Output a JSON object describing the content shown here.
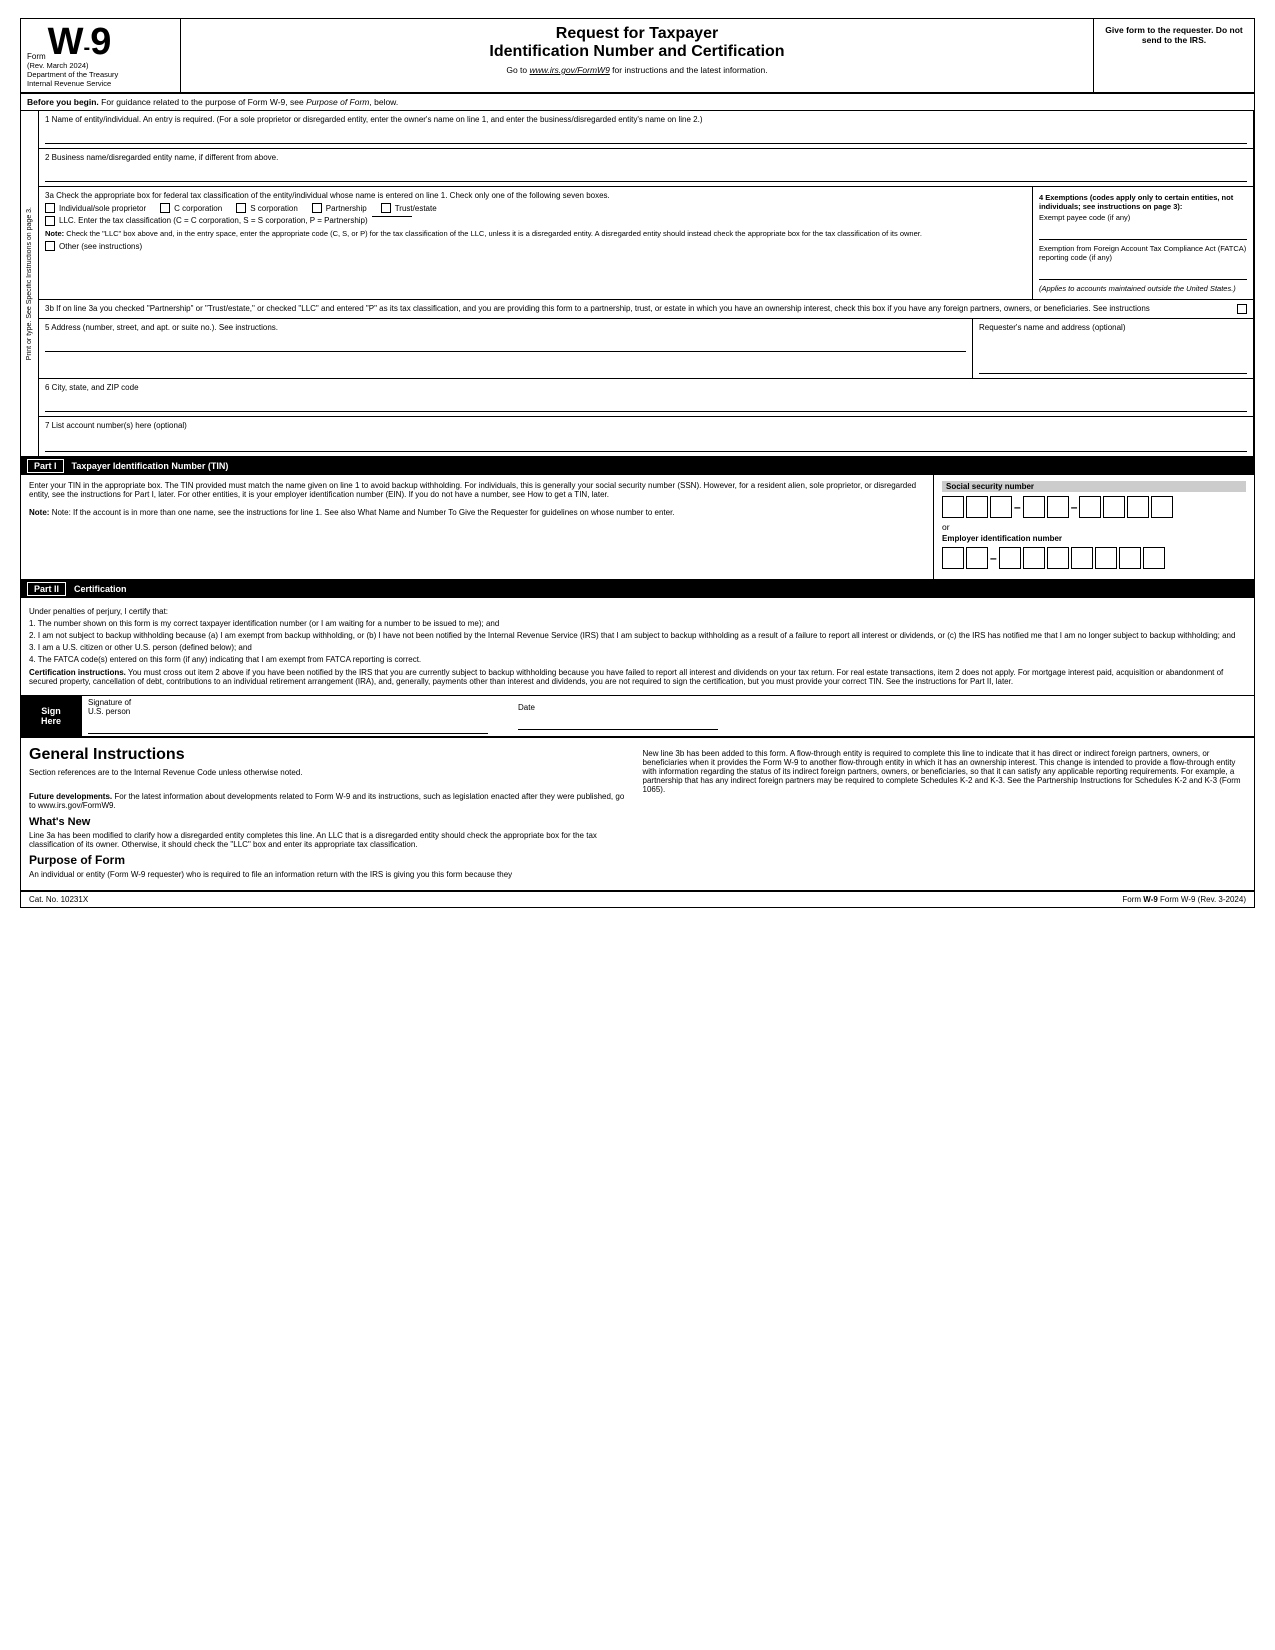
{
  "header": {
    "form_label": "Form",
    "form_number": "W-9",
    "rev_date": "(Rev. March 2024)",
    "dept": "Department of the Treasury",
    "irs": "Internal Revenue Service",
    "title1": "Request for Taxpayer",
    "title2": "Identification Number and Certification",
    "instructions_link": "Go to www.irs.gov/FormW9 for instructions and the latest information.",
    "give_form": "Give form to the requester. Do not send to the IRS."
  },
  "begin_bar": {
    "text": "Before you begin. For guidance related to the purpose of Form W-9, see Purpose of Form, below."
  },
  "fields": {
    "field1_label": "1  Name of entity/individual. An entry is required. (For a sole proprietor or disregarded entity, enter the owner's name on line 1, and enter the business/disregarded entity's name on line 2.)",
    "field2_label": "2  Business name/disregarded entity name, if different from above.",
    "field3a_label": "3a Check the appropriate box for federal tax classification of the entity/individual whose name is entered on line 1. Check only one of the following seven boxes.",
    "checkbox1": "Individual/sole proprietor",
    "checkbox2": "C corporation",
    "checkbox3": "S corporation",
    "checkbox4": "Partnership",
    "checkbox5": "Trust/estate",
    "llc_label": "LLC. Enter the tax classification (C = C corporation, S = S corporation, P = Partnership)",
    "note_label": "Note:",
    "note_text": "Check the \"LLC\" box above and, in the entry space, enter the appropriate code (C, S, or P) for the tax classification of the LLC, unless it is a disregarded entity. A disregarded entity should instead check the appropriate box for the tax classification of its owner.",
    "other_label": "Other (see instructions)",
    "field4_label": "4 Exemptions (codes apply only to certain entities, not individuals; see instructions on page 3):",
    "exempt_payee": "Exempt payee code (if any)",
    "fatca_label": "Exemption from Foreign Account Tax Compliance Act (FATCA) reporting code (if any)",
    "applies_label": "(Applies to accounts maintained outside the United States.)",
    "field3b_text": "3b If on line 3a you checked \"Partnership\" or \"Trust/estate,\" or checked \"LLC\" and entered \"P\" as its tax classification, and you are providing this form to a partnership, trust, or estate in which you have an ownership interest, check this box if you have any foreign partners, owners, or beneficiaries. See instructions",
    "field5_label": "5  Address (number, street, and apt. or suite no.). See instructions.",
    "requester_label": "Requester's name and address (optional)",
    "field6_label": "6  City, state, and ZIP code",
    "field7_label": "7  List account number(s) here (optional)"
  },
  "part1": {
    "label": "Part I",
    "title": "Taxpayer Identification Number (TIN)",
    "instructions": "Enter your TIN in the appropriate box. The TIN provided must match the name given on line 1 to avoid backup withholding. For individuals, this is generally your social security number (SSN). However, for a resident alien, sole proprietor, or disregarded entity, see the instructions for Part I, later. For other entities, it is your employer identification number (EIN). If you do not have a number, see How to get a TIN, later.",
    "note": "Note: If the account is in more than one name, see the instructions for line 1. See also What Name and Number To Give the Requester for guidelines on whose number to enter.",
    "ssn_label": "Social security number",
    "or_label": "or",
    "ein_label": "Employer identification number"
  },
  "part2": {
    "label": "Part II",
    "title": "Certification",
    "intro": "Under penalties of perjury, I certify that:",
    "item1": "1. The number shown on this form is my correct taxpayer identification number (or I am waiting for a number to be issued to me); and",
    "item2": "2. I am not subject to backup withholding because (a) I am exempt from backup withholding, or (b) I have not been notified by the Internal Revenue Service (IRS) that I am subject to backup withholding as a result of a failure to report all interest or dividends, or (c) the IRS has notified me that I am no longer subject to backup withholding; and",
    "item3": "3. I am a U.S. citizen or other U.S. person (defined below); and",
    "item4": "4. The FATCA code(s) entered on this form (if any) indicating that I am exempt from FATCA reporting is correct.",
    "cert_instructions_label": "Certification instructions.",
    "cert_instructions": "You must cross out item 2 above if you have been notified by the IRS that you are currently subject to backup withholding because you have failed to report all interest and dividends on your tax return. For real estate transactions, item 2 does not apply. For mortgage interest paid, acquisition or abandonment of secured property, cancellation of debt, contributions to an individual retirement arrangement (IRA), and, generally, payments other than interest and dividends, you are not required to sign the certification, but you must provide your correct TIN. See the instructions for Part II, later."
  },
  "sign": {
    "label": "Sign\nHere",
    "sig_label": "Signature of",
    "sig_sublabel": "U.S. person",
    "date_label": "Date"
  },
  "general_instructions": {
    "title": "General Instructions",
    "section_refs": "Section references are to the Internal Revenue Code unless otherwise noted.",
    "future_dev_label": "Future developments.",
    "future_dev": "For the latest information about developments related to Form W-9 and its instructions, such as legislation enacted after they were published, go to www.irs.gov/FormW9.",
    "whats_new_title": "What's New",
    "whats_new_text": "Line 3a has been modified to clarify how a disregarded entity completes this line. An LLC that is a disregarded entity should check the appropriate box for the tax classification of its owner. Otherwise, it should check the \"LLC\" box and enter its appropriate tax classification.",
    "purpose_title": "Purpose of Form",
    "purpose_text": "An individual or entity (Form W-9 requester) who is required to file an information return with the IRS is giving you this form because they",
    "right_col_text": "New line 3b has been added to this form. A flow-through entity is required to complete this line to indicate that it has direct or indirect foreign partners, owners, or beneficiaries when it provides the Form W-9 to another flow-through entity in which it has an ownership interest. This change is intended to provide a flow-through entity with information regarding the status of its indirect foreign partners, owners, or beneficiaries, so that it can satisfy any applicable reporting requirements. For example, a partnership that has any indirect foreign partners may be required to complete Schedules K-2 and K-3. See the Partnership Instructions for Schedules K-2 and K-3 (Form 1065)."
  },
  "footer": {
    "cat_no": "Cat. No. 10231X",
    "form_ref": "Form W-9 (Rev. 3-2024)"
  }
}
